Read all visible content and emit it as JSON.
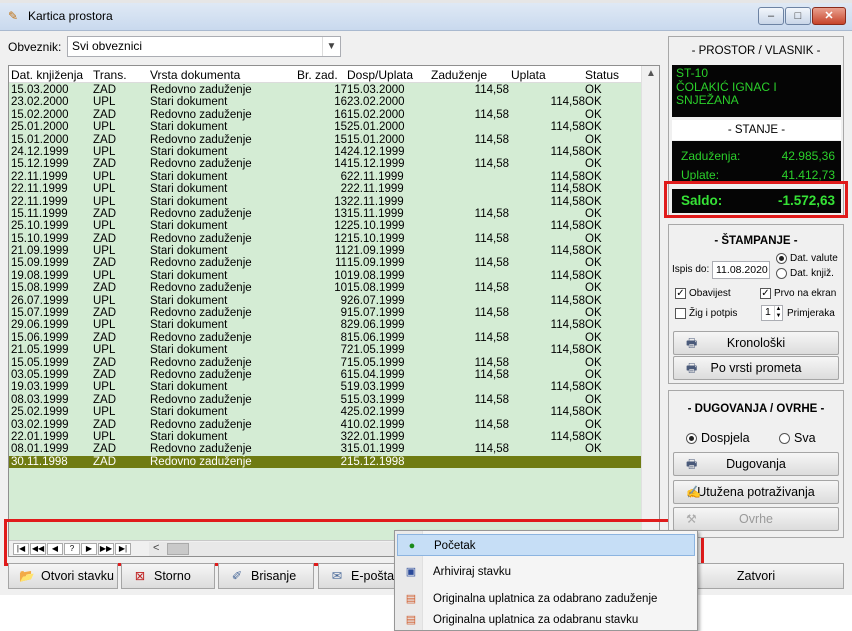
{
  "window": {
    "title": "Kartica prostora",
    "min": "–",
    "max": "□",
    "close": "✕"
  },
  "filter": {
    "label": "Obveznik:",
    "value": "Svi obveznici"
  },
  "grid": {
    "headers": [
      "Dat. knjiženja",
      "Trans.",
      "Vrsta dokumenta",
      "Br. zad.",
      "Dosp/Uplata",
      "Zaduženje",
      "Uplata",
      "Status"
    ],
    "rows": [
      [
        "15.03.2000",
        "ZAD",
        "Redovno zaduženje",
        "17",
        "15.03.2000",
        "114,58",
        "",
        "OK"
      ],
      [
        "23.02.2000",
        "UPL",
        "Stari dokument",
        "16",
        "23.02.2000",
        "",
        "114,58",
        "OK"
      ],
      [
        "15.02.2000",
        "ZAD",
        "Redovno zaduženje",
        "16",
        "15.02.2000",
        "114,58",
        "",
        "OK"
      ],
      [
        "25.01.2000",
        "UPL",
        "Stari dokument",
        "15",
        "25.01.2000",
        "",
        "114,58",
        "OK"
      ],
      [
        "15.01.2000",
        "ZAD",
        "Redovno zaduženje",
        "15",
        "15.01.2000",
        "114,58",
        "",
        "OK"
      ],
      [
        "24.12.1999",
        "UPL",
        "Stari dokument",
        "14",
        "24.12.1999",
        "",
        "114,58",
        "OK"
      ],
      [
        "15.12.1999",
        "ZAD",
        "Redovno zaduženje",
        "14",
        "15.12.1999",
        "114,58",
        "",
        "OK"
      ],
      [
        "22.11.1999",
        "UPL",
        "Stari dokument",
        "6",
        "22.11.1999",
        "",
        "114,58",
        "OK"
      ],
      [
        "22.11.1999",
        "UPL",
        "Stari dokument",
        "2",
        "22.11.1999",
        "",
        "114,58",
        "OK"
      ],
      [
        "22.11.1999",
        "UPL",
        "Stari dokument",
        "13",
        "22.11.1999",
        "",
        "114,58",
        "OK"
      ],
      [
        "15.11.1999",
        "ZAD",
        "Redovno zaduženje",
        "13",
        "15.11.1999",
        "114,58",
        "",
        "OK"
      ],
      [
        "25.10.1999",
        "UPL",
        "Stari dokument",
        "12",
        "25.10.1999",
        "",
        "114,58",
        "OK"
      ],
      [
        "15.10.1999",
        "ZAD",
        "Redovno zaduženje",
        "12",
        "15.10.1999",
        "114,58",
        "",
        "OK"
      ],
      [
        "21.09.1999",
        "UPL",
        "Stari dokument",
        "11",
        "21.09.1999",
        "",
        "114,58",
        "OK"
      ],
      [
        "15.09.1999",
        "ZAD",
        "Redovno zaduženje",
        "11",
        "15.09.1999",
        "114,58",
        "",
        "OK"
      ],
      [
        "19.08.1999",
        "UPL",
        "Stari dokument",
        "10",
        "19.08.1999",
        "",
        "114,58",
        "OK"
      ],
      [
        "15.08.1999",
        "ZAD",
        "Redovno zaduženje",
        "10",
        "15.08.1999",
        "114,58",
        "",
        "OK"
      ],
      [
        "26.07.1999",
        "UPL",
        "Stari dokument",
        "9",
        "26.07.1999",
        "",
        "114,58",
        "OK"
      ],
      [
        "15.07.1999",
        "ZAD",
        "Redovno zaduženje",
        "9",
        "15.07.1999",
        "114,58",
        "",
        "OK"
      ],
      [
        "29.06.1999",
        "UPL",
        "Stari dokument",
        "8",
        "29.06.1999",
        "",
        "114,58",
        "OK"
      ],
      [
        "15.06.1999",
        "ZAD",
        "Redovno zaduženje",
        "8",
        "15.06.1999",
        "114,58",
        "",
        "OK"
      ],
      [
        "21.05.1999",
        "UPL",
        "Stari dokument",
        "7",
        "21.05.1999",
        "",
        "114,58",
        "OK"
      ],
      [
        "15.05.1999",
        "ZAD",
        "Redovno zaduženje",
        "7",
        "15.05.1999",
        "114,58",
        "",
        "OK"
      ],
      [
        "03.05.1999",
        "ZAD",
        "Redovno zaduženje",
        "6",
        "15.04.1999",
        "114,58",
        "",
        "OK"
      ],
      [
        "19.03.1999",
        "UPL",
        "Stari dokument",
        "5",
        "19.03.1999",
        "",
        "114,58",
        "OK"
      ],
      [
        "08.03.1999",
        "ZAD",
        "Redovno zaduženje",
        "5",
        "15.03.1999",
        "114,58",
        "",
        "OK"
      ],
      [
        "25.02.1999",
        "UPL",
        "Stari dokument",
        "4",
        "25.02.1999",
        "",
        "114,58",
        "OK"
      ],
      [
        "03.02.1999",
        "ZAD",
        "Redovno zaduženje",
        "4",
        "10.02.1999",
        "114,58",
        "",
        "OK"
      ],
      [
        "22.01.1999",
        "UPL",
        "Stari dokument",
        "3",
        "22.01.1999",
        "",
        "114,58",
        "OK"
      ],
      [
        "08.01.1999",
        "ZAD",
        "Redovno zaduženje",
        "3",
        "15.01.1999",
        "114,58",
        "",
        "OK"
      ],
      [
        "30.11.1998",
        "ZAD",
        "Redovno zaduženje",
        "2",
        "15.12.1998",
        "",
        "",
        ""
      ]
    ],
    "selected_row": 30,
    "nav_buttons": [
      "|◀",
      "◀◀",
      "◀",
      "?",
      "▶",
      "▶▶",
      "▶|"
    ]
  },
  "info": {
    "header": "- PROSTOR / VLASNIK -",
    "name_lines": [
      "ST-10",
      "ČOLAKIĆ IGNAC I",
      "SNJEŽANA"
    ],
    "stanje_header": "- STANJE -",
    "zaduzenja_label": "Zaduženja:",
    "zaduzenja_value": "42.985,36",
    "uplate_label": "Uplate:",
    "uplate_value": "41.412,73",
    "saldo_label": "Saldo:",
    "saldo_value": "-1.572,63"
  },
  "stampanje": {
    "header": "- ŠTAMPANJE -",
    "ispis_label": "Ispis do:",
    "ispis_date": "11.08.2020",
    "radio_valute": "Dat. valute",
    "radio_knjiz": "Dat. knjiž.",
    "chk_obavijest": "Obavijest",
    "chk_prvo": "Prvo na ekran",
    "chk_zig": "Žig i potpis",
    "copies": "1",
    "copies_label": "Primjeraka",
    "btn_kronoloski": "Kronološki",
    "btn_po_vrsti": "Po vrsti prometa"
  },
  "dugovanja": {
    "header": "- DUGOVANJA / OVRHE -",
    "radio_dospjela": "Dospjela",
    "radio_sva": "Sva",
    "btn_dugovanja": "Dugovanja",
    "btn_utuzena": "Utužena potraživanja",
    "btn_ovrhe": "Ovrhe"
  },
  "bottom": {
    "otvori": "Otvori stavku",
    "storno": "Storno",
    "brisanje": "Brisanje",
    "eposta": "E-pošta",
    "zatvori": "Zatvori"
  },
  "context_menu": {
    "items": [
      "Početak",
      "Arhiviraj stavku",
      "Originalna uplatnica za odabrano zaduženje",
      "Originalna uplatnica za odabranu stavku"
    ]
  },
  "colors": {
    "grid_bg": "#d4ecd4",
    "selected_row": "#6f7b12",
    "lcd_text": "#2bd02b",
    "highlight": "#e01b1b"
  }
}
